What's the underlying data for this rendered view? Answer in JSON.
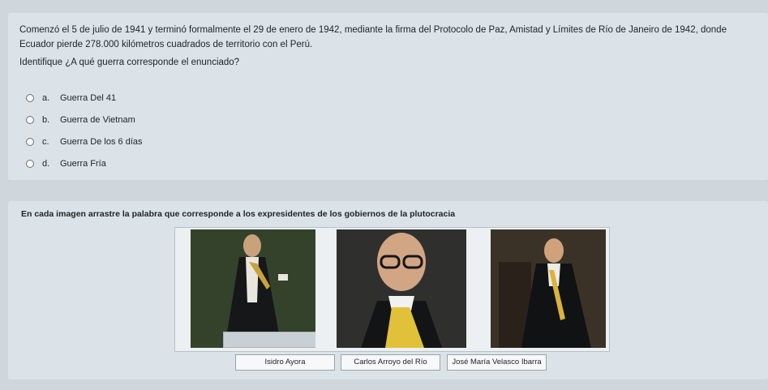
{
  "question1": {
    "text": "Comenzó el 5 de julio de 1941 y terminó formalmente el 29 de enero de 1942, mediante la firma del Protocolo de Paz, Amistad y Límites de Río de Janeiro de 1942, donde Ecuador pierde 278.000 kilómetros cuadrados de territorio con el Perú.",
    "prompt": "Identifique ¿A qué guerra corresponde el enunciado?",
    "options": [
      {
        "letter": "a.",
        "label": "Guerra Del 41"
      },
      {
        "letter": "b.",
        "label": "Guerra de Vietnam"
      },
      {
        "letter": "c.",
        "label": "Guerra De los 6 días"
      },
      {
        "letter": "d.",
        "label": "Guerra Fría"
      }
    ]
  },
  "question2": {
    "title": "En cada imagen arrastre la palabra que corresponde a los expresidentes de los gobiernos de la plutocracia",
    "drag_items": [
      "Isidro Ayora",
      "Carlos Arroyo del Río",
      "José María Velasco Ibarra"
    ]
  }
}
